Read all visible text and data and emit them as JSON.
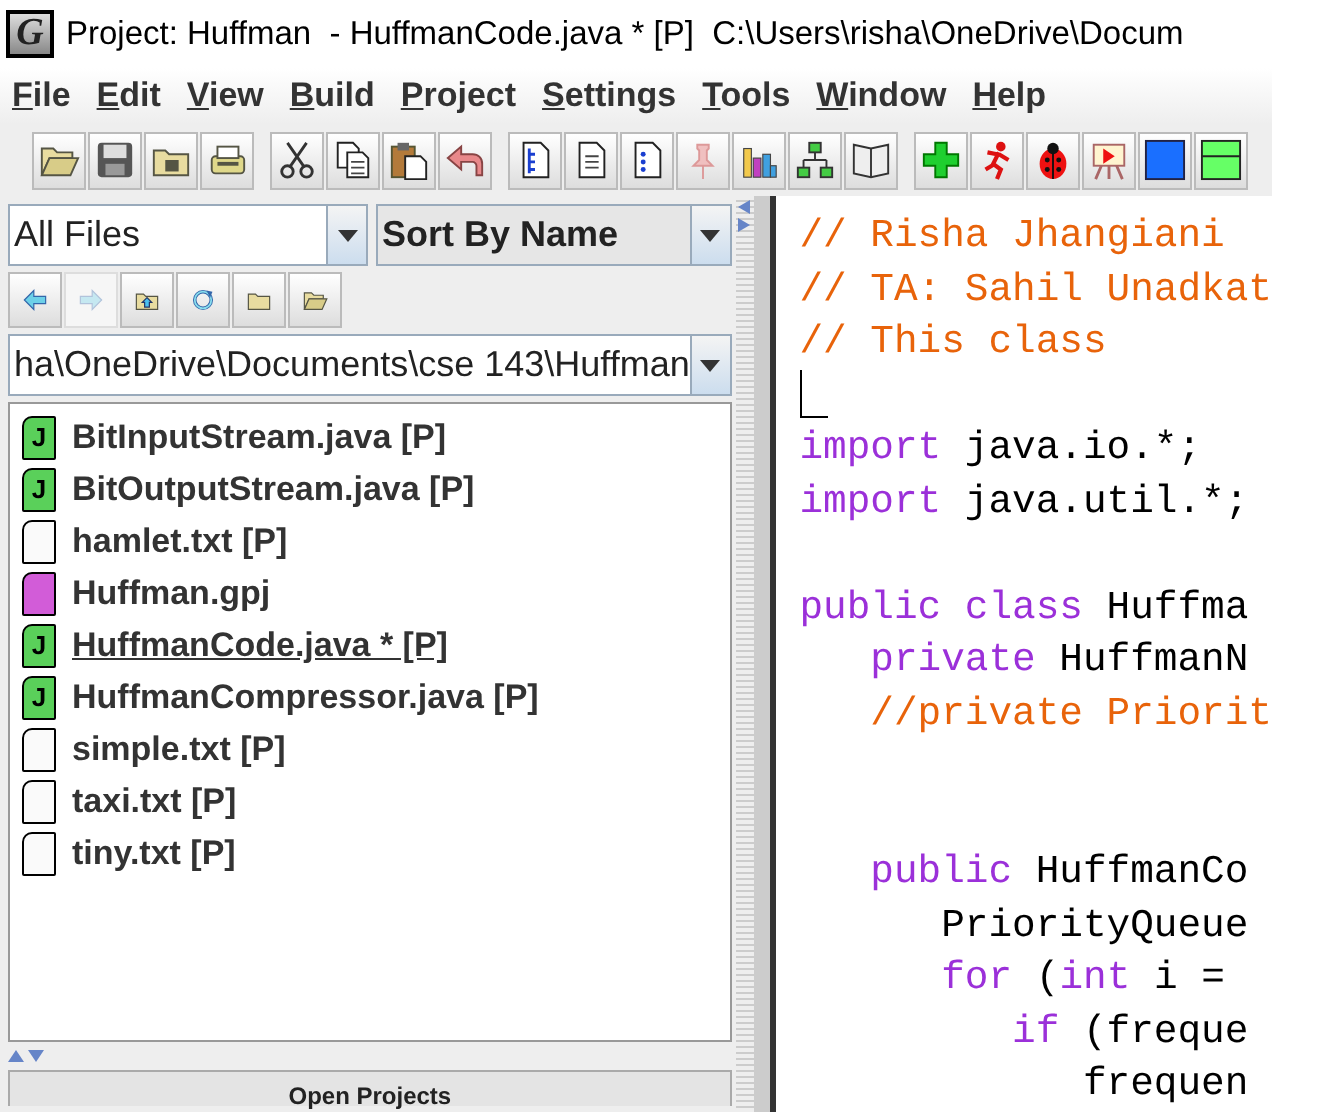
{
  "window": {
    "logo": "G",
    "title": "Project: Huffman  - HuffmanCode.java * [P]  C:\\Users\\risha\\OneDrive\\Docum"
  },
  "menu": [
    {
      "label": "File"
    },
    {
      "label": "Edit"
    },
    {
      "label": "View"
    },
    {
      "label": "Build"
    },
    {
      "label": "Project"
    },
    {
      "label": "Settings"
    },
    {
      "label": "Tools"
    },
    {
      "label": "Window"
    },
    {
      "label": "Help"
    }
  ],
  "browser": {
    "filter": "All Files",
    "sort": "Sort By Name",
    "path": "ha\\OneDrive\\Documents\\cse 143\\Huffman",
    "nav_buttons": [
      {
        "kind": "back",
        "disabled": false
      },
      {
        "kind": "forward",
        "disabled": true
      },
      {
        "kind": "up",
        "disabled": false
      },
      {
        "kind": "refresh",
        "disabled": false
      },
      {
        "kind": "folder",
        "disabled": false
      },
      {
        "kind": "open",
        "disabled": false
      }
    ],
    "files": [
      {
        "name": "BitInputStream.java [P]",
        "kind": "java",
        "icon_letter": "J",
        "selected": false
      },
      {
        "name": "BitOutputStream.java [P]",
        "kind": "java",
        "icon_letter": "J",
        "selected": false
      },
      {
        "name": "hamlet.txt [P]",
        "kind": "text",
        "selected": false
      },
      {
        "name": "Huffman.gpj",
        "kind": "project",
        "selected": false
      },
      {
        "name": "HuffmanCode.java * [P]",
        "kind": "java",
        "icon_letter": "J",
        "selected": true
      },
      {
        "name": "HuffmanCompressor.java [P]",
        "kind": "java",
        "icon_letter": "J",
        "selected": false
      },
      {
        "name": "simple.txt [P]",
        "kind": "text",
        "selected": false
      },
      {
        "name": "taxi.txt [P]",
        "kind": "text",
        "selected": false
      },
      {
        "name": "tiny.txt [P]",
        "kind": "text",
        "selected": false
      }
    ],
    "bottom_tab": "Open Projects"
  },
  "editor": {
    "lines": [
      {
        "cursor": false,
        "tokens": [
          {
            "text": "// Risha Jhangiani",
            "kind": "comment"
          }
        ]
      },
      {
        "cursor": false,
        "tokens": [
          {
            "text": "// TA: Sahil Unadkat",
            "kind": "comment"
          }
        ]
      },
      {
        "cursor": false,
        "tokens": [
          {
            "text": "// This class",
            "kind": "comment"
          }
        ]
      },
      {
        "cursor": true
      },
      {
        "cursor": false,
        "tokens": [
          {
            "text": "import",
            "kind": "keyword"
          },
          {
            "text": " java.io.*;",
            "kind": "plain"
          }
        ]
      },
      {
        "cursor": false,
        "tokens": [
          {
            "text": "import",
            "kind": "keyword"
          },
          {
            "text": " java.util.*;",
            "kind": "plain"
          }
        ]
      },
      {
        "cursor": false
      },
      {
        "cursor": false,
        "tokens": [
          {
            "text": "public class",
            "kind": "keyword"
          },
          {
            "text": " Huffma",
            "kind": "plain"
          }
        ]
      },
      {
        "cursor": false,
        "tokens": [
          {
            "text": "   private",
            "kind": "keyword"
          },
          {
            "text": " HuffmanN",
            "kind": "plain"
          }
        ]
      },
      {
        "cursor": false,
        "tokens": [
          {
            "text": "   //private Priorit",
            "kind": "comment"
          }
        ]
      },
      {
        "cursor": false
      },
      {
        "cursor": false
      },
      {
        "cursor": false,
        "tokens": [
          {
            "text": "   public",
            "kind": "keyword"
          },
          {
            "text": " HuffmanCo",
            "kind": "plain"
          }
        ]
      },
      {
        "cursor": false,
        "tokens": [
          {
            "text": "      PriorityQueue",
            "kind": "plain"
          }
        ]
      },
      {
        "cursor": false,
        "tokens": [
          {
            "text": "      for",
            "kind": "keyword"
          },
          {
            "text": " (",
            "kind": "plain"
          },
          {
            "text": "int",
            "kind": "keyword"
          },
          {
            "text": " i = ",
            "kind": "plain"
          }
        ]
      },
      {
        "cursor": false,
        "tokens": [
          {
            "text": "         if",
            "kind": "keyword"
          },
          {
            "text": " (freque",
            "kind": "plain"
          }
        ]
      },
      {
        "cursor": false,
        "tokens": [
          {
            "text": "            frequen",
            "kind": "plain"
          }
        ]
      }
    ]
  }
}
